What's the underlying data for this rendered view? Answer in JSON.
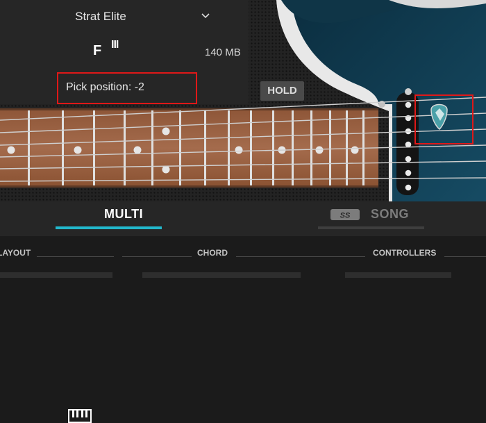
{
  "preset": {
    "name": "Strat Elite",
    "key": "F",
    "key_modifier": "III",
    "size": "140 MB",
    "pick_position": "Pick position: -2"
  },
  "hold_label": "HOLD",
  "tabs": [
    {
      "label": "MULTI",
      "icon": "piano-keys-icon",
      "active": true
    },
    {
      "label": "SONG",
      "icon": "song-badge-icon",
      "active": false
    }
  ],
  "sections": [
    "LAYOUT",
    "CHORD",
    "CONTROLLERS"
  ],
  "colors": {
    "accent": "#22b8cc",
    "highlight": "#e01818",
    "guitar_body": "#0e3a4e",
    "fretboard": "#9a6244"
  }
}
